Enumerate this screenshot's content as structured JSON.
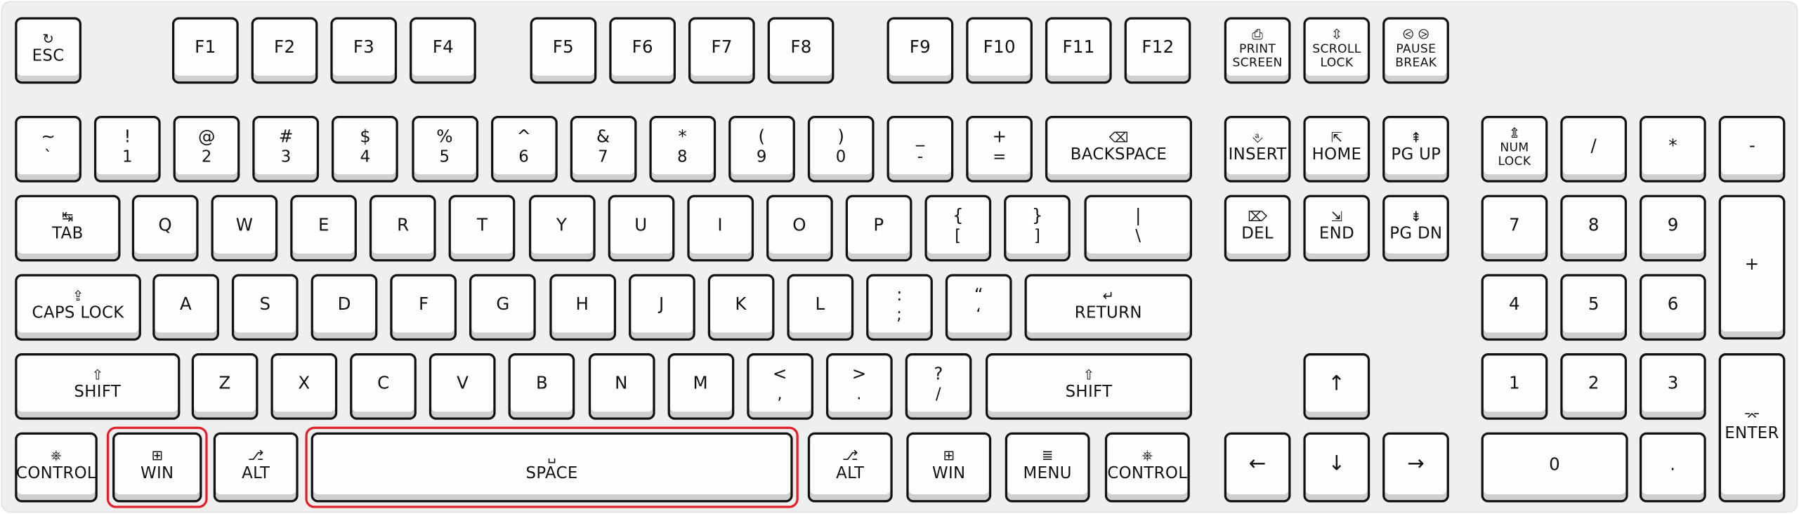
{
  "highlight_color": "#e0202a",
  "rows": [
    {
      "keys": [
        {
          "label": "ESC",
          "icon": "escape-icon"
        },
        {
          "label": "F1"
        },
        {
          "label": "F2"
        },
        {
          "label": "F3"
        },
        {
          "label": "F4"
        },
        {
          "label": "F5"
        },
        {
          "label": "F6"
        },
        {
          "label": "F7"
        },
        {
          "label": "F8"
        },
        {
          "label": "F9"
        },
        {
          "label": "F10"
        },
        {
          "label": "F11"
        },
        {
          "label": "F12"
        },
        {
          "label": "PRINT\nSCREEN",
          "icon": "print-screen-icon",
          "small": true
        },
        {
          "label": "SCROLL\nLOCK",
          "icon": "scroll-lock-icon",
          "small": true
        },
        {
          "label": "PAUSE\nBREAK",
          "icon": "pause-break-icon",
          "small": true
        }
      ]
    },
    {
      "keys": [
        {
          "top": "~",
          "label": "`"
        },
        {
          "top": "!",
          "label": "1"
        },
        {
          "top": "@",
          "label": "2"
        },
        {
          "top": "#",
          "label": "3"
        },
        {
          "top": "$",
          "label": "4"
        },
        {
          "top": "%",
          "label": "5"
        },
        {
          "top": "^",
          "label": "6"
        },
        {
          "top": "&",
          "label": "7"
        },
        {
          "top": "*",
          "label": "8"
        },
        {
          "top": "(",
          "label": "9"
        },
        {
          "top": ")",
          "label": "0"
        },
        {
          "top": "_",
          "label": "-"
        },
        {
          "top": "+",
          "label": "="
        },
        {
          "label": "BACKSPACE",
          "icon": "backspace-icon"
        },
        {
          "label": "INSERT",
          "icon": "insert-icon"
        },
        {
          "label": "HOME",
          "icon": "home-icon"
        },
        {
          "label": "PG UP",
          "icon": "page-up-icon"
        },
        {
          "label": "NUM\nLOCK",
          "icon": "num-lock-icon",
          "small": true
        },
        {
          "label": "/"
        },
        {
          "label": "*"
        },
        {
          "label": "-"
        }
      ]
    },
    {
      "keys": [
        {
          "label": "TAB",
          "icon": "tab-icon"
        },
        {
          "label": "Q"
        },
        {
          "label": "W"
        },
        {
          "label": "E"
        },
        {
          "label": "R"
        },
        {
          "label": "T"
        },
        {
          "label": "Y"
        },
        {
          "label": "U"
        },
        {
          "label": "I"
        },
        {
          "label": "O"
        },
        {
          "label": "P"
        },
        {
          "top": "{",
          "label": "["
        },
        {
          "top": "}",
          "label": "]"
        },
        {
          "top": "|",
          "label": "\\"
        },
        {
          "label": "DEL",
          "icon": "delete-icon"
        },
        {
          "label": "END",
          "icon": "end-icon"
        },
        {
          "label": "PG DN",
          "icon": "page-down-icon"
        },
        {
          "label": "7"
        },
        {
          "label": "8"
        },
        {
          "label": "9"
        },
        {
          "label": "+"
        }
      ]
    },
    {
      "keys": [
        {
          "label": "CAPS LOCK",
          "icon": "caps-lock-icon"
        },
        {
          "label": "A"
        },
        {
          "label": "S"
        },
        {
          "label": "D"
        },
        {
          "label": "F"
        },
        {
          "label": "G"
        },
        {
          "label": "H"
        },
        {
          "label": "J"
        },
        {
          "label": "K"
        },
        {
          "label": "L"
        },
        {
          "top": ":",
          "label": ";"
        },
        {
          "top": "“",
          "label": "‘"
        },
        {
          "label": "RETURN",
          "icon": "return-icon"
        },
        {
          "label": "4"
        },
        {
          "label": "5"
        },
        {
          "label": "6"
        }
      ]
    },
    {
      "keys": [
        {
          "label": "SHIFT",
          "icon": "shift-icon"
        },
        {
          "label": "Z"
        },
        {
          "label": "X"
        },
        {
          "label": "C"
        },
        {
          "label": "V"
        },
        {
          "label": "B"
        },
        {
          "label": "N"
        },
        {
          "label": "M"
        },
        {
          "top": "<",
          "label": ","
        },
        {
          "top": ">",
          "label": "."
        },
        {
          "top": "?",
          "label": "/"
        },
        {
          "label": "SHIFT",
          "icon": "shift-icon"
        },
        {
          "label": "↑",
          "icon_only": true,
          "name": "arrow-up"
        },
        {
          "label": "1"
        },
        {
          "label": "2"
        },
        {
          "label": "3"
        },
        {
          "label": "ENTER",
          "icon": "enter-icon"
        }
      ]
    },
    {
      "keys": [
        {
          "label": "CONTROL",
          "icon": "control-icon"
        },
        {
          "label": "WIN",
          "icon": "windows-icon",
          "highlighted": true
        },
        {
          "label": "ALT",
          "icon": "alt-icon"
        },
        {
          "label": "SPACE",
          "icon": "space-icon",
          "highlighted": true
        },
        {
          "label": "ALT",
          "icon": "alt-icon"
        },
        {
          "label": "WIN",
          "icon": "windows-icon"
        },
        {
          "label": "MENU",
          "icon": "menu-icon"
        },
        {
          "label": "CONTROL",
          "icon": "control-icon"
        },
        {
          "label": "←",
          "icon_only": true,
          "name": "arrow-left"
        },
        {
          "label": "↓",
          "icon_only": true,
          "name": "arrow-down"
        },
        {
          "label": "→",
          "icon_only": true,
          "name": "arrow-right"
        },
        {
          "label": "0"
        },
        {
          "label": "."
        }
      ]
    }
  ]
}
